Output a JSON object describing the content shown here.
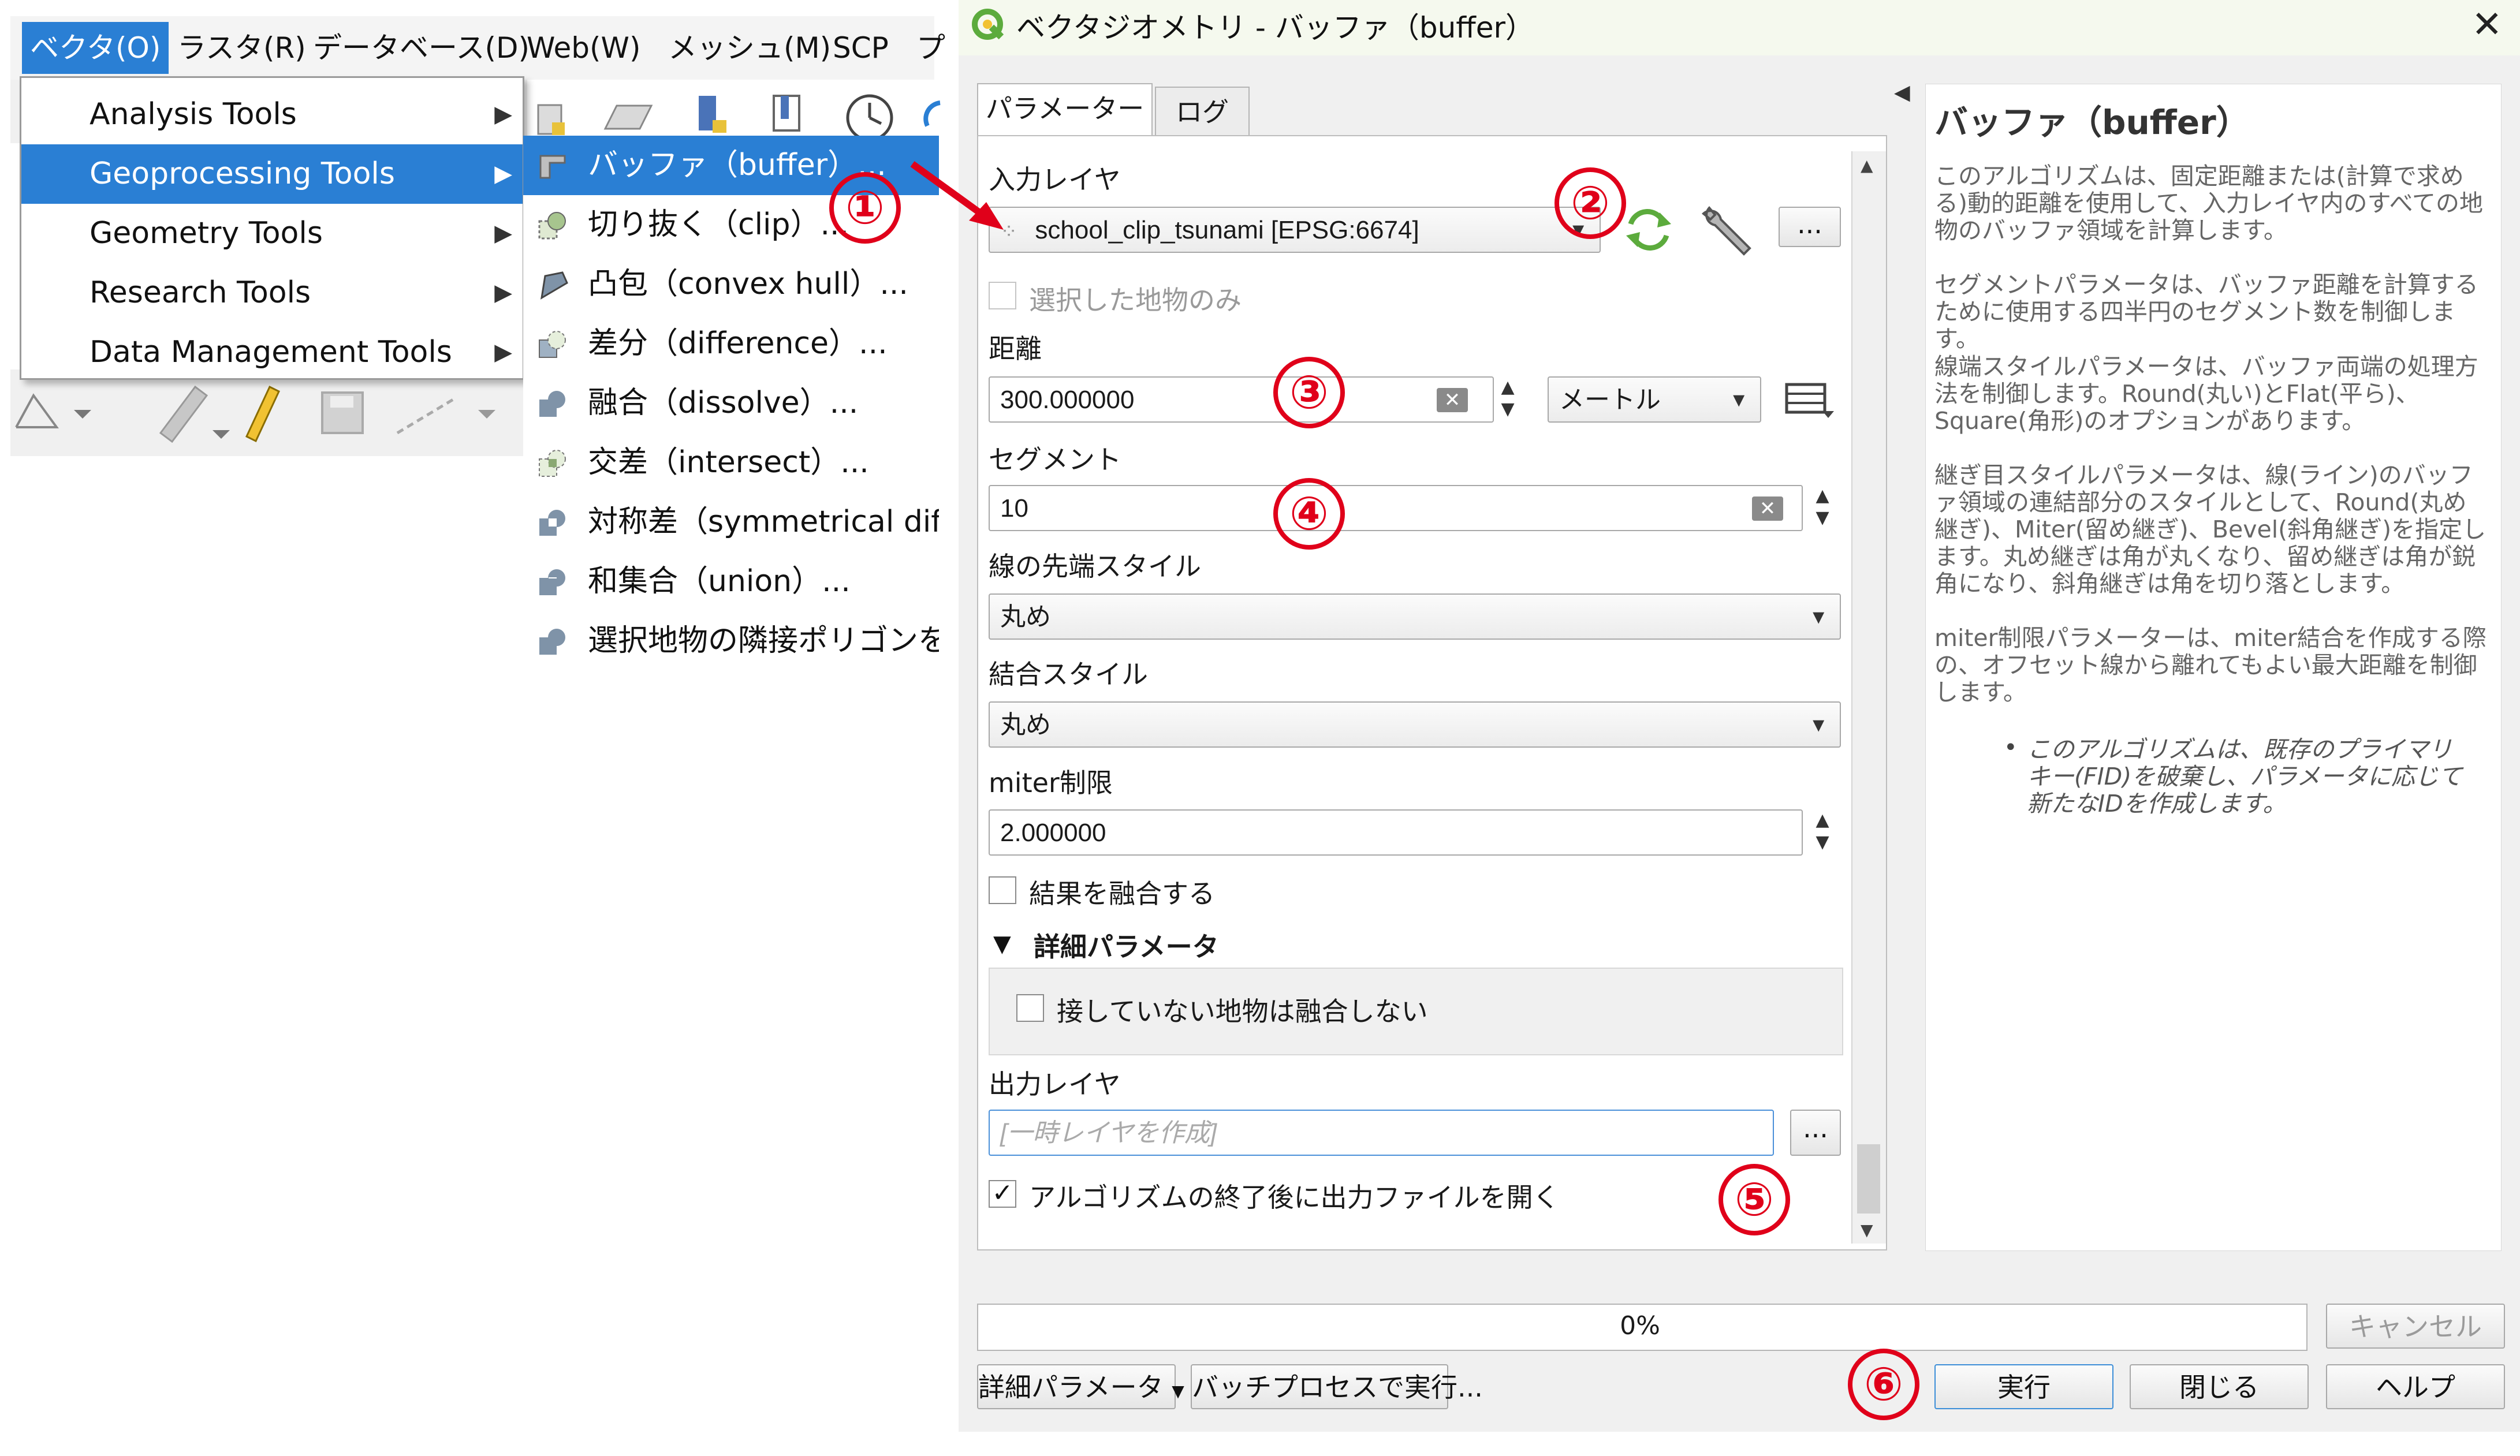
{
  "qgis_menubar": {
    "items": [
      "ベクタ(O)",
      "ラスタ(R)",
      "データベース(D)",
      "Web(W)",
      "メッシュ(M)",
      "SCP",
      "プ"
    ]
  },
  "vector_menu": {
    "items": [
      "Analysis Tools",
      "Geoprocessing Tools",
      "Geometry Tools",
      "Research Tools",
      "Data Management Tools"
    ]
  },
  "geoprocessing_submenu": {
    "items": [
      "バッファ（buffer）...",
      "切り抜く（clip）...",
      "凸包（convex hull）...",
      "差分（difference）...",
      "融合（dissolve）...",
      "交差（intersect）...",
      "対称差（symmetrical differ",
      "和集合（union）...",
      "選択地物の隣接ポリゴンを融"
    ]
  },
  "annotations": [
    "①",
    "②",
    "③",
    "④",
    "⑤",
    "⑥"
  ],
  "colors": {
    "accent": "#2a7fd4",
    "annotation": "#e0001a",
    "qgis_green": "#5cab3d"
  },
  "dialog": {
    "title": "ベクタジオメトリ - バッファ（buffer）",
    "tabs": [
      "パラメーター",
      "ログ"
    ],
    "input_layer_label": "入力レイヤ",
    "input_layer_value": "school_clip_tsunami [EPSG:6674]",
    "selected_only_label": "選択した地物のみ",
    "distance_label": "距離",
    "distance_value": "300.000000",
    "distance_unit": "メートル",
    "segments_label": "セグメント",
    "segments_value": "10",
    "end_cap_label": "線の先端スタイル",
    "end_cap_value": "丸め",
    "join_style_label": "結合スタイル",
    "join_style_value": "丸め",
    "miter_label": "miter制限",
    "miter_value": "2.000000",
    "dissolve_label": "結果を融合する",
    "advanced_label": "詳細パラメータ",
    "no_dissolve_disjoint_label": "接していない地物は融合しない",
    "output_label": "出力レイヤ",
    "output_placeholder": "[一時レイヤを作成]",
    "open_output_label": "アルゴリズムの終了後に出力ファイルを開く",
    "ellipsis": "...",
    "progress_text": "0%",
    "buttons": {
      "cancel": "キャンセル",
      "advanced": "詳細パラメータ",
      "batch": "バッチプロセスで実行...",
      "run": "実行",
      "close": "閉じる",
      "help": "ヘルプ"
    }
  },
  "help": {
    "title": "バッファ（buffer）",
    "paragraphs": [
      "このアルゴリズムは、固定距離または(計算で求める)動的距離を使用して、入力レイヤ内のすべての地物のバッファ領域を計算します。",
      "セグメントパラメータは、バッファ距離を計算するために使用する四半円のセグメント数を制御します。",
      "線端スタイルパラメータは、バッファ両端の処理方法を制御します。Round(丸い)とFlat(平ら)、Square(角形)のオプションがあります。",
      "継ぎ目スタイルパラメータは、線(ライン)のバッファ領域の連結部分のスタイルとして、Round(丸め継ぎ)、Miter(留め継ぎ)、Bevel(斜角継ぎ)を指定します。丸め継ぎは角が丸くなり、留め継ぎは角が鋭角になり、斜角継ぎは角を切り落とします。",
      "miter制限パラメーターは、miter結合を作成する際の、オフセット線から離れてもよい最大距離を制御します。"
    ],
    "note": "このアルゴリズムは、既存のプライマリキー(FID)を破棄し、パラメータに応じて新たなIDを作成します。"
  }
}
